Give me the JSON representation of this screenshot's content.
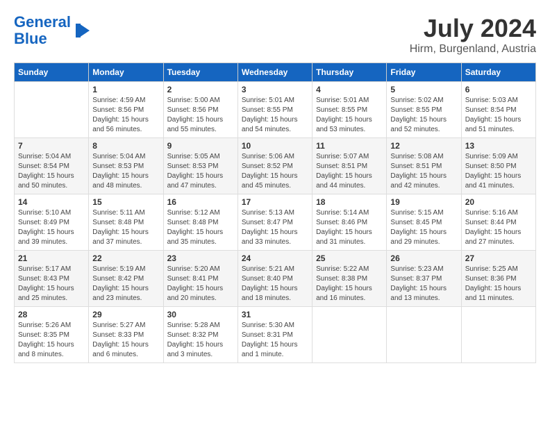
{
  "logo": {
    "line1": "General",
    "line2": "Blue"
  },
  "title": {
    "month_year": "July 2024",
    "location": "Hirm, Burgenland, Austria"
  },
  "weekdays": [
    "Sunday",
    "Monday",
    "Tuesday",
    "Wednesday",
    "Thursday",
    "Friday",
    "Saturday"
  ],
  "weeks": [
    [
      {
        "day": "",
        "info": ""
      },
      {
        "day": "1",
        "info": "Sunrise: 4:59 AM\nSunset: 8:56 PM\nDaylight: 15 hours\nand 56 minutes."
      },
      {
        "day": "2",
        "info": "Sunrise: 5:00 AM\nSunset: 8:56 PM\nDaylight: 15 hours\nand 55 minutes."
      },
      {
        "day": "3",
        "info": "Sunrise: 5:01 AM\nSunset: 8:55 PM\nDaylight: 15 hours\nand 54 minutes."
      },
      {
        "day": "4",
        "info": "Sunrise: 5:01 AM\nSunset: 8:55 PM\nDaylight: 15 hours\nand 53 minutes."
      },
      {
        "day": "5",
        "info": "Sunrise: 5:02 AM\nSunset: 8:55 PM\nDaylight: 15 hours\nand 52 minutes."
      },
      {
        "day": "6",
        "info": "Sunrise: 5:03 AM\nSunset: 8:54 PM\nDaylight: 15 hours\nand 51 minutes."
      }
    ],
    [
      {
        "day": "7",
        "info": "Sunrise: 5:04 AM\nSunset: 8:54 PM\nDaylight: 15 hours\nand 50 minutes."
      },
      {
        "day": "8",
        "info": "Sunrise: 5:04 AM\nSunset: 8:53 PM\nDaylight: 15 hours\nand 48 minutes."
      },
      {
        "day": "9",
        "info": "Sunrise: 5:05 AM\nSunset: 8:53 PM\nDaylight: 15 hours\nand 47 minutes."
      },
      {
        "day": "10",
        "info": "Sunrise: 5:06 AM\nSunset: 8:52 PM\nDaylight: 15 hours\nand 45 minutes."
      },
      {
        "day": "11",
        "info": "Sunrise: 5:07 AM\nSunset: 8:51 PM\nDaylight: 15 hours\nand 44 minutes."
      },
      {
        "day": "12",
        "info": "Sunrise: 5:08 AM\nSunset: 8:51 PM\nDaylight: 15 hours\nand 42 minutes."
      },
      {
        "day": "13",
        "info": "Sunrise: 5:09 AM\nSunset: 8:50 PM\nDaylight: 15 hours\nand 41 minutes."
      }
    ],
    [
      {
        "day": "14",
        "info": "Sunrise: 5:10 AM\nSunset: 8:49 PM\nDaylight: 15 hours\nand 39 minutes."
      },
      {
        "day": "15",
        "info": "Sunrise: 5:11 AM\nSunset: 8:48 PM\nDaylight: 15 hours\nand 37 minutes."
      },
      {
        "day": "16",
        "info": "Sunrise: 5:12 AM\nSunset: 8:48 PM\nDaylight: 15 hours\nand 35 minutes."
      },
      {
        "day": "17",
        "info": "Sunrise: 5:13 AM\nSunset: 8:47 PM\nDaylight: 15 hours\nand 33 minutes."
      },
      {
        "day": "18",
        "info": "Sunrise: 5:14 AM\nSunset: 8:46 PM\nDaylight: 15 hours\nand 31 minutes."
      },
      {
        "day": "19",
        "info": "Sunrise: 5:15 AM\nSunset: 8:45 PM\nDaylight: 15 hours\nand 29 minutes."
      },
      {
        "day": "20",
        "info": "Sunrise: 5:16 AM\nSunset: 8:44 PM\nDaylight: 15 hours\nand 27 minutes."
      }
    ],
    [
      {
        "day": "21",
        "info": "Sunrise: 5:17 AM\nSunset: 8:43 PM\nDaylight: 15 hours\nand 25 minutes."
      },
      {
        "day": "22",
        "info": "Sunrise: 5:19 AM\nSunset: 8:42 PM\nDaylight: 15 hours\nand 23 minutes."
      },
      {
        "day": "23",
        "info": "Sunrise: 5:20 AM\nSunset: 8:41 PM\nDaylight: 15 hours\nand 20 minutes."
      },
      {
        "day": "24",
        "info": "Sunrise: 5:21 AM\nSunset: 8:40 PM\nDaylight: 15 hours\nand 18 minutes."
      },
      {
        "day": "25",
        "info": "Sunrise: 5:22 AM\nSunset: 8:38 PM\nDaylight: 15 hours\nand 16 minutes."
      },
      {
        "day": "26",
        "info": "Sunrise: 5:23 AM\nSunset: 8:37 PM\nDaylight: 15 hours\nand 13 minutes."
      },
      {
        "day": "27",
        "info": "Sunrise: 5:25 AM\nSunset: 8:36 PM\nDaylight: 15 hours\nand 11 minutes."
      }
    ],
    [
      {
        "day": "28",
        "info": "Sunrise: 5:26 AM\nSunset: 8:35 PM\nDaylight: 15 hours\nand 8 minutes."
      },
      {
        "day": "29",
        "info": "Sunrise: 5:27 AM\nSunset: 8:33 PM\nDaylight: 15 hours\nand 6 minutes."
      },
      {
        "day": "30",
        "info": "Sunrise: 5:28 AM\nSunset: 8:32 PM\nDaylight: 15 hours\nand 3 minutes."
      },
      {
        "day": "31",
        "info": "Sunrise: 5:30 AM\nSunset: 8:31 PM\nDaylight: 15 hours\nand 1 minute."
      },
      {
        "day": "",
        "info": ""
      },
      {
        "day": "",
        "info": ""
      },
      {
        "day": "",
        "info": ""
      }
    ]
  ]
}
